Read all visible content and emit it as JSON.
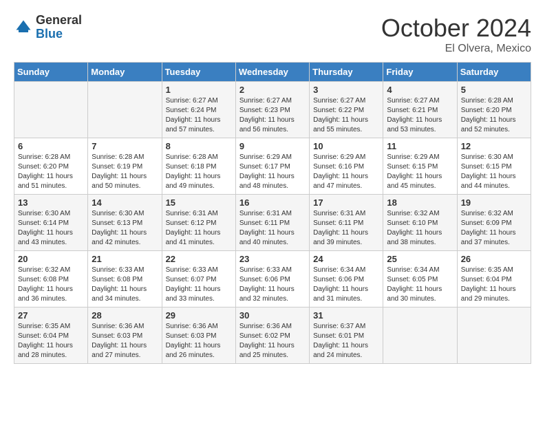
{
  "header": {
    "logo_general": "General",
    "logo_blue": "Blue",
    "month": "October 2024",
    "location": "El Olvera, Mexico"
  },
  "days_of_week": [
    "Sunday",
    "Monday",
    "Tuesday",
    "Wednesday",
    "Thursday",
    "Friday",
    "Saturday"
  ],
  "weeks": [
    [
      {
        "day": "",
        "info": ""
      },
      {
        "day": "",
        "info": ""
      },
      {
        "day": "1",
        "info": "Sunrise: 6:27 AM\nSunset: 6:24 PM\nDaylight: 11 hours and 57 minutes."
      },
      {
        "day": "2",
        "info": "Sunrise: 6:27 AM\nSunset: 6:23 PM\nDaylight: 11 hours and 56 minutes."
      },
      {
        "day": "3",
        "info": "Sunrise: 6:27 AM\nSunset: 6:22 PM\nDaylight: 11 hours and 55 minutes."
      },
      {
        "day": "4",
        "info": "Sunrise: 6:27 AM\nSunset: 6:21 PM\nDaylight: 11 hours and 53 minutes."
      },
      {
        "day": "5",
        "info": "Sunrise: 6:28 AM\nSunset: 6:20 PM\nDaylight: 11 hours and 52 minutes."
      }
    ],
    [
      {
        "day": "6",
        "info": "Sunrise: 6:28 AM\nSunset: 6:20 PM\nDaylight: 11 hours and 51 minutes."
      },
      {
        "day": "7",
        "info": "Sunrise: 6:28 AM\nSunset: 6:19 PM\nDaylight: 11 hours and 50 minutes."
      },
      {
        "day": "8",
        "info": "Sunrise: 6:28 AM\nSunset: 6:18 PM\nDaylight: 11 hours and 49 minutes."
      },
      {
        "day": "9",
        "info": "Sunrise: 6:29 AM\nSunset: 6:17 PM\nDaylight: 11 hours and 48 minutes."
      },
      {
        "day": "10",
        "info": "Sunrise: 6:29 AM\nSunset: 6:16 PM\nDaylight: 11 hours and 47 minutes."
      },
      {
        "day": "11",
        "info": "Sunrise: 6:29 AM\nSunset: 6:15 PM\nDaylight: 11 hours and 45 minutes."
      },
      {
        "day": "12",
        "info": "Sunrise: 6:30 AM\nSunset: 6:15 PM\nDaylight: 11 hours and 44 minutes."
      }
    ],
    [
      {
        "day": "13",
        "info": "Sunrise: 6:30 AM\nSunset: 6:14 PM\nDaylight: 11 hours and 43 minutes."
      },
      {
        "day": "14",
        "info": "Sunrise: 6:30 AM\nSunset: 6:13 PM\nDaylight: 11 hours and 42 minutes."
      },
      {
        "day": "15",
        "info": "Sunrise: 6:31 AM\nSunset: 6:12 PM\nDaylight: 11 hours and 41 minutes."
      },
      {
        "day": "16",
        "info": "Sunrise: 6:31 AM\nSunset: 6:11 PM\nDaylight: 11 hours and 40 minutes."
      },
      {
        "day": "17",
        "info": "Sunrise: 6:31 AM\nSunset: 6:11 PM\nDaylight: 11 hours and 39 minutes."
      },
      {
        "day": "18",
        "info": "Sunrise: 6:32 AM\nSunset: 6:10 PM\nDaylight: 11 hours and 38 minutes."
      },
      {
        "day": "19",
        "info": "Sunrise: 6:32 AM\nSunset: 6:09 PM\nDaylight: 11 hours and 37 minutes."
      }
    ],
    [
      {
        "day": "20",
        "info": "Sunrise: 6:32 AM\nSunset: 6:08 PM\nDaylight: 11 hours and 36 minutes."
      },
      {
        "day": "21",
        "info": "Sunrise: 6:33 AM\nSunset: 6:08 PM\nDaylight: 11 hours and 34 minutes."
      },
      {
        "day": "22",
        "info": "Sunrise: 6:33 AM\nSunset: 6:07 PM\nDaylight: 11 hours and 33 minutes."
      },
      {
        "day": "23",
        "info": "Sunrise: 6:33 AM\nSunset: 6:06 PM\nDaylight: 11 hours and 32 minutes."
      },
      {
        "day": "24",
        "info": "Sunrise: 6:34 AM\nSunset: 6:06 PM\nDaylight: 11 hours and 31 minutes."
      },
      {
        "day": "25",
        "info": "Sunrise: 6:34 AM\nSunset: 6:05 PM\nDaylight: 11 hours and 30 minutes."
      },
      {
        "day": "26",
        "info": "Sunrise: 6:35 AM\nSunset: 6:04 PM\nDaylight: 11 hours and 29 minutes."
      }
    ],
    [
      {
        "day": "27",
        "info": "Sunrise: 6:35 AM\nSunset: 6:04 PM\nDaylight: 11 hours and 28 minutes."
      },
      {
        "day": "28",
        "info": "Sunrise: 6:36 AM\nSunset: 6:03 PM\nDaylight: 11 hours and 27 minutes."
      },
      {
        "day": "29",
        "info": "Sunrise: 6:36 AM\nSunset: 6:03 PM\nDaylight: 11 hours and 26 minutes."
      },
      {
        "day": "30",
        "info": "Sunrise: 6:36 AM\nSunset: 6:02 PM\nDaylight: 11 hours and 25 minutes."
      },
      {
        "day": "31",
        "info": "Sunrise: 6:37 AM\nSunset: 6:01 PM\nDaylight: 11 hours and 24 minutes."
      },
      {
        "day": "",
        "info": ""
      },
      {
        "day": "",
        "info": ""
      }
    ]
  ]
}
